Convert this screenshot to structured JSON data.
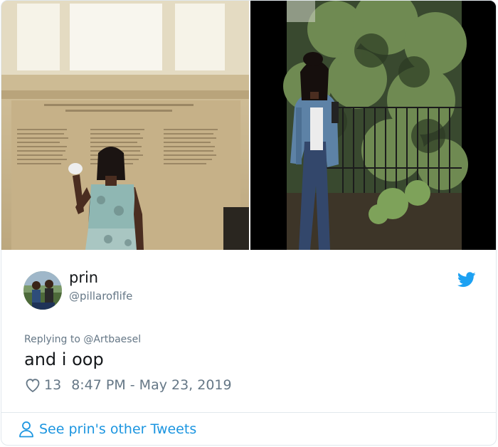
{
  "tweet": {
    "author_name": "prin",
    "author_handle": "@pillaroflife",
    "replying_prefix": "Replying to",
    "replying_to": "@Artbaesel",
    "text": "and i oop",
    "like_count": "13",
    "timestamp": "8:47 PM - May 23, 2019"
  },
  "footer": {
    "link_label": "See prin's other Tweets"
  },
  "colors": {
    "accent": "#1da1f2",
    "link": "#1b95e0",
    "muted": "#657786",
    "text": "#14171a"
  },
  "icons": {
    "brand": "twitter-bird-icon",
    "like": "heart-icon",
    "profile": "person-icon"
  }
}
